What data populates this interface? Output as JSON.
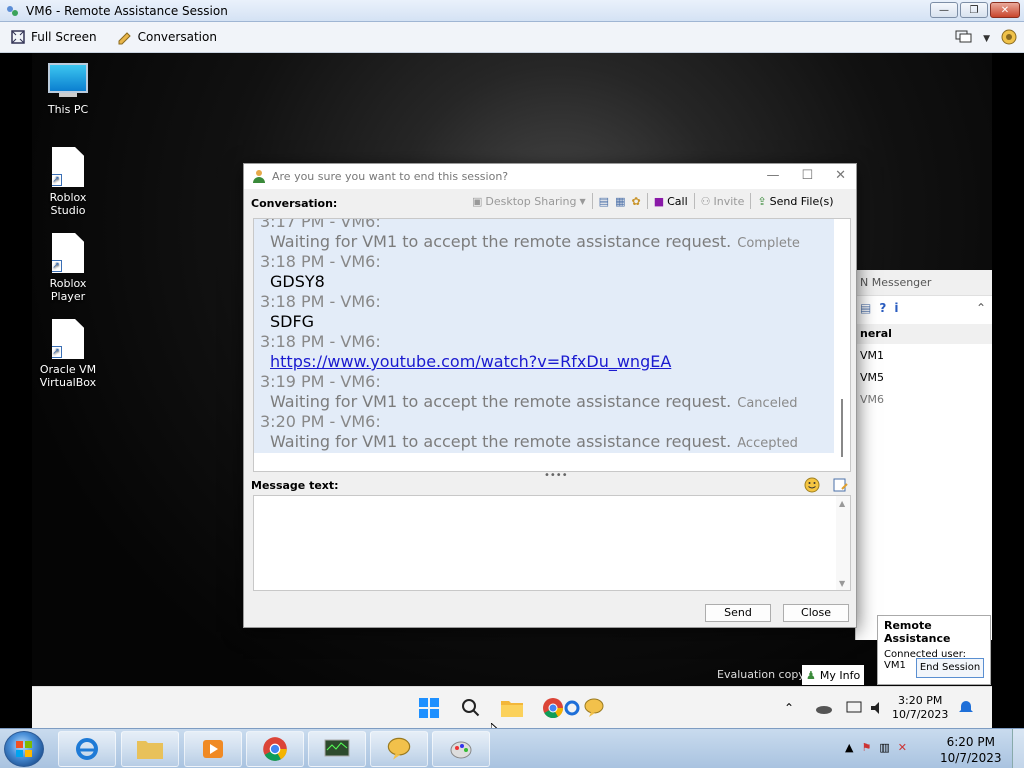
{
  "outer_window": {
    "title": "VM6 - Remote Assistance Session",
    "toolbar": {
      "full_screen": "Full Screen",
      "conversation": "Conversation"
    }
  },
  "desktop": {
    "icons": [
      {
        "label": "This PC"
      },
      {
        "label": "Roblox Studio"
      },
      {
        "label": "Roblox Player"
      },
      {
        "label": "Oracle VM VirtualBox"
      }
    ],
    "evaluation_text": "Evaluation copy"
  },
  "messenger": {
    "title": "N Messenger",
    "group": "neral",
    "contacts": [
      "VM1",
      "VM5",
      "VM6"
    ]
  },
  "dialog": {
    "title": "Are you sure you want to end this session?",
    "conversation_label": "Conversation:",
    "toolbar": {
      "desktop_sharing": "Desktop Sharing",
      "call": "Call",
      "invite": "Invite",
      "send_files": "Send File(s)"
    },
    "log": [
      {
        "kind": "header",
        "text": "3:17 PM - VM6:"
      },
      {
        "kind": "system",
        "text": "Waiting for VM1 to accept the remote assistance request.",
        "status": "Complete"
      },
      {
        "kind": "header",
        "text": "3:18 PM - VM6:"
      },
      {
        "kind": "message",
        "text": "GDSY8"
      },
      {
        "kind": "header",
        "text": "3:18 PM - VM6:"
      },
      {
        "kind": "message",
        "text": "SDFG"
      },
      {
        "kind": "header",
        "text": "3:18 PM - VM6:"
      },
      {
        "kind": "link",
        "text": "https://www.youtube.com/watch?v=RfxDu_wngEA"
      },
      {
        "kind": "header",
        "text": "3:19 PM - VM6:"
      },
      {
        "kind": "system",
        "text": "Waiting for VM1 to accept the remote assistance request.",
        "status": "Canceled"
      },
      {
        "kind": "header",
        "text": "3:20 PM - VM6:"
      },
      {
        "kind": "system",
        "text": "Waiting for VM1 to accept the remote assistance request.",
        "status": "Accepted"
      }
    ],
    "message_label": "Message text:",
    "message_value": "",
    "send": "Send",
    "close": "Close"
  },
  "notification": {
    "title": "Remote Assistance",
    "connected": "Connected user: VM1",
    "end_session": "End Session"
  },
  "my_info": "My Info",
  "remote_taskbar": {
    "time": "3:20 PM",
    "date": "10/7/2023"
  },
  "host_taskbar": {
    "time": "6:20 PM",
    "date": "10/7/2023"
  }
}
